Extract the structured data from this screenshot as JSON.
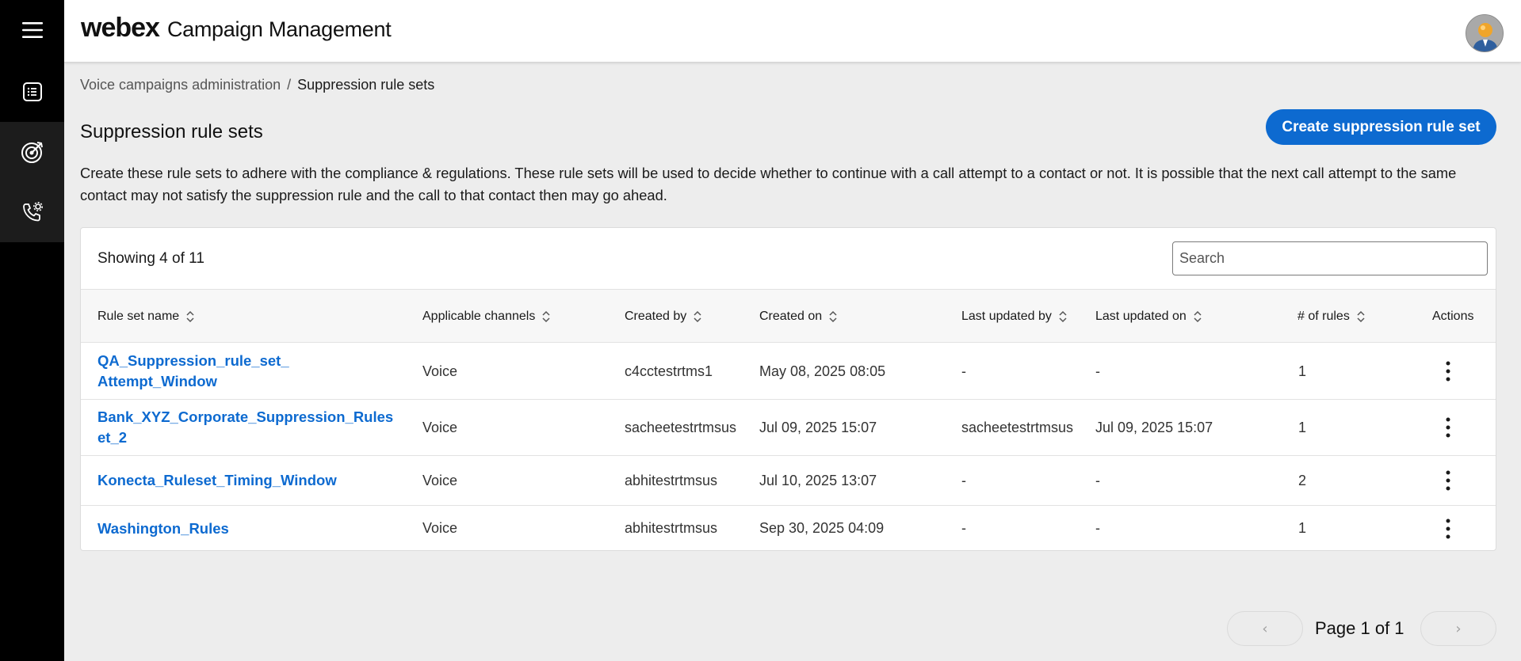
{
  "app": {
    "logo": "webex",
    "title": "Campaign Management"
  },
  "rail": {
    "items": [
      {
        "icon": "hamburger-menu-icon"
      },
      {
        "icon": "list-document-icon"
      },
      {
        "icon": "target-icon"
      },
      {
        "icon": "phone-settings-icon"
      }
    ]
  },
  "breadcrumb": {
    "parent": "Voice campaigns administration",
    "separator": "/",
    "current": "Suppression rule sets"
  },
  "page": {
    "title": "Suppression rule sets",
    "create_button": "Create suppression rule set",
    "description": "Create these rule sets to adhere with the compliance & regulations. These rule sets will be used to decide whether to continue with a call attempt to a contact or not. It is possible that the next call attempt to the same contact may not satisfy the suppression rule and the call to that contact then may go ahead."
  },
  "table": {
    "showing_prefix": "Showing",
    "showing_count": "4",
    "showing_of": "of 11",
    "search_placeholder": "Search",
    "columns": [
      "Rule set name",
      "Applicable channels",
      "Created by",
      "Created on",
      "Last updated by",
      "Last updated on",
      "# of rules",
      "Actions"
    ],
    "rows": [
      {
        "name": "QA_Suppression_rule_set_ Attempt_Window",
        "channels": "Voice",
        "created_by": "c4cctestrtms1",
        "created_on": "May 08, 2025 08:05",
        "updated_by": "-",
        "updated_on": "-",
        "rules": "1"
      },
      {
        "name": "Bank_XYZ_Corporate_Suppression_Rules et_2",
        "channels": "Voice",
        "created_by": "sacheetestrtmsus",
        "created_on": "Jul 09, 2025 15:07",
        "updated_by": "sacheetestrtmsus",
        "updated_on": "Jul 09, 2025 15:07",
        "rules": "1"
      },
      {
        "name": "Konecta_Ruleset_Timing_Window",
        "channels": "Voice",
        "created_by": "abhitestrtmsus",
        "created_on": "Jul 10, 2025 13:07",
        "updated_by": "-",
        "updated_on": "-",
        "rules": "2"
      },
      {
        "name": "Washington_Rules",
        "channels": "Voice",
        "created_by": "abhitestrtmsus",
        "created_on": "Sep 30, 2025 04:09",
        "updated_by": "-",
        "updated_on": "-",
        "rules": "1"
      }
    ]
  },
  "pagination": {
    "prev": "‹",
    "next": "›",
    "label": "Page 1 of 1"
  }
}
